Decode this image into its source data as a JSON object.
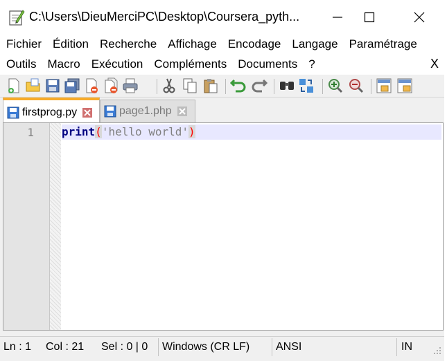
{
  "window": {
    "title": "C:\\Users\\DieuMerciPC\\Desktop\\Coursera_pyth...",
    "icon": "notepad-plus-plus-icon",
    "controls": [
      "minimize-icon",
      "maximize-icon",
      "close-icon"
    ]
  },
  "menubar": {
    "row1": [
      "Fichier",
      "Édition",
      "Recherche",
      "Affichage",
      "Encodage",
      "Langage",
      "Paramétrage"
    ],
    "row2": [
      "Outils",
      "Macro",
      "Exécution",
      "Compléments",
      "Documents",
      "?"
    ],
    "close_doc": "X"
  },
  "toolbar": {
    "icons": [
      "new-file-icon",
      "open-file-icon",
      "save-icon",
      "save-all-icon",
      "close-icon",
      "close-all-icon",
      "print-icon",
      "cut-icon",
      "copy-icon",
      "paste-icon",
      "undo-icon",
      "redo-icon",
      "find-icon",
      "replace-icon",
      "zoom-in-icon",
      "zoom-out-icon",
      "sync-vertical-icon",
      "sync-horizontal-icon"
    ]
  },
  "tabs": [
    {
      "label": "firstprog.py",
      "active": true
    },
    {
      "label": "page1.php",
      "active": false
    }
  ],
  "editor": {
    "line_number": "1",
    "code": {
      "keyword": "print",
      "open_paren": "(",
      "string": "'hello world'",
      "close_paren": ")"
    }
  },
  "status": {
    "ln": "Ln : 1",
    "col": "Col : 21",
    "sel": "Sel : 0 | 0",
    "eol": "Windows (CR LF)",
    "encoding": "ANSI",
    "mode": "IN"
  },
  "colors": {
    "keyword": "#000080",
    "operator": "#ff0000",
    "string": "#808080",
    "active_tab_accent": "#f7ab29",
    "current_line": "#e8e8ff"
  }
}
